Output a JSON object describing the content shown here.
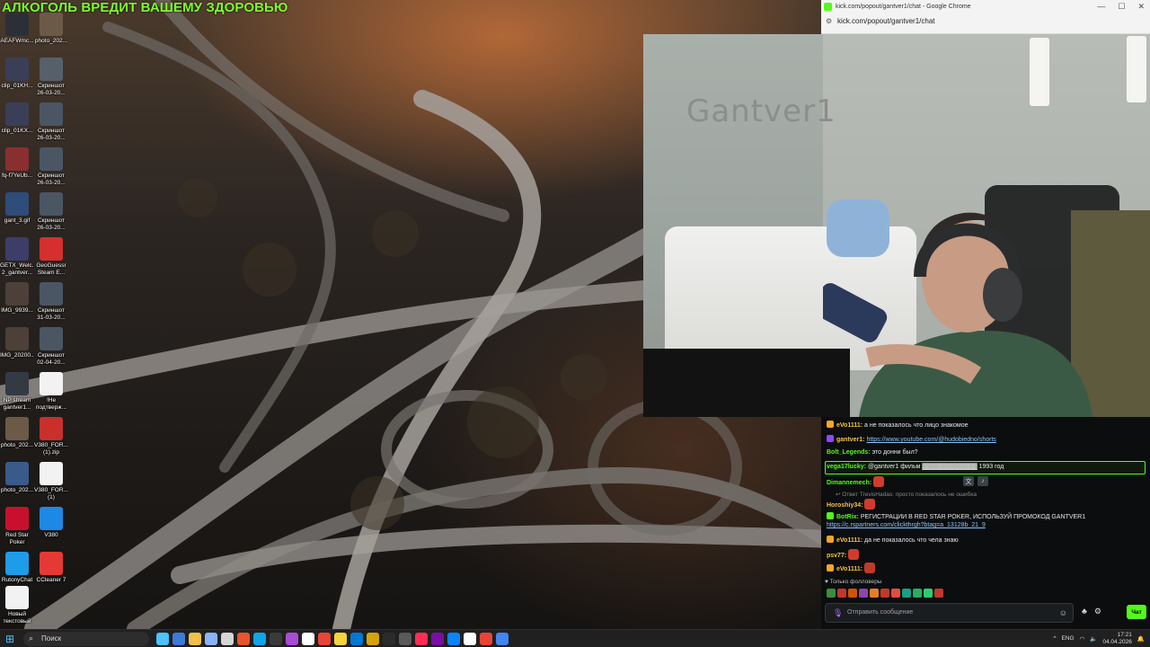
{
  "overlay": {
    "warning_text": "АЛКОГОЛЬ ВРЕДИТ ВАШЕМУ ЗДОРОВЬЮ"
  },
  "desktop": {
    "icons": [
      {
        "label": "AEAFWmc...",
        "icon": "file-icon",
        "color": "#2b2f36"
      },
      {
        "label": "photo_202...",
        "icon": "image-icon",
        "color": "#6b5a48"
      },
      {
        "label": "clip_01KH...",
        "icon": "video-icon",
        "color": "#3a3f57"
      },
      {
        "label": "Скриншот 26-03-20...",
        "icon": "screenshot-icon",
        "color": "#56606a"
      },
      {
        "label": "clip_01KX...",
        "icon": "video-icon",
        "color": "#3a3f57"
      },
      {
        "label": "Скриншот 26-03-20...",
        "icon": "screenshot-icon",
        "color": "#4b5664"
      },
      {
        "label": "fq-f7YeUb...",
        "icon": "image-icon",
        "color": "#8a2f2f"
      },
      {
        "label": "Скриншот 26-03-20...",
        "icon": "screenshot-icon",
        "color": "#4b5664"
      },
      {
        "label": "gant_3.gif",
        "icon": "gif-icon",
        "color": "#2f4d7a"
      },
      {
        "label": "Скриншот 26-03-20...",
        "icon": "screenshot-icon",
        "color": "#4b5664"
      },
      {
        "label": "GETX_Welc... 2_gantver...",
        "icon": "image-icon",
        "color": "#3d3d6a"
      },
      {
        "label": "GeoGuessr Steam E...",
        "icon": "map-pin-icon",
        "color": "#d62f2f"
      },
      {
        "label": "IMG_9939...",
        "icon": "image-icon",
        "color": "#4c4038"
      },
      {
        "label": "Скриншот 31-03-20...",
        "icon": "screenshot-icon",
        "color": "#4b5664"
      },
      {
        "label": "IMG_20200...",
        "icon": "image-icon",
        "color": "#4c4038"
      },
      {
        "label": "Скриншот 02-04-20...",
        "icon": "screenshot-icon",
        "color": "#4b5664"
      },
      {
        "label": "NP stream gantver1...",
        "icon": "document-icon",
        "color": "#333a44"
      },
      {
        "label": "!Не подтверж...",
        "icon": "text-file-icon",
        "color": "#f2f2f2"
      },
      {
        "label": "photo_202...",
        "icon": "image-icon",
        "color": "#6b5a48"
      },
      {
        "label": "V380_FOR... (1).zip",
        "icon": "archive-icon",
        "color": "#c9302c"
      },
      {
        "label": "photo_202...",
        "icon": "image-icon",
        "color": "#3a5a8a"
      },
      {
        "label": "V380_FOR... (1)",
        "icon": "app-icon",
        "color": "#f2f2f2"
      },
      {
        "label": "Red Star Poker",
        "icon": "poker-icon",
        "color": "#c8102e"
      },
      {
        "label": "V380",
        "icon": "camera-app-icon",
        "color": "#1e88e5"
      },
      {
        "label": "RutonyChat",
        "icon": "chat-app-icon",
        "color": "#1e9be9"
      },
      {
        "label": "CCleaner 7",
        "icon": "ccleaner-icon",
        "color": "#e53935"
      },
      {
        "label": "Новый текстовый ...",
        "icon": "text-file-icon",
        "color": "#f2f2f2"
      }
    ]
  },
  "browser": {
    "title": "kick.com/popout/gantver1/chat - Google Chrome",
    "url": "kick.com/popout/gantver1/chat",
    "controls": [
      "—",
      "☐",
      "✕"
    ]
  },
  "webcam": {
    "wall_logo": "Gantver1"
  },
  "chat": {
    "messages": [
      {
        "user": "eVo1111:",
        "user_color": "#f5c242",
        "badge_color": "#f5a623",
        "text": "а не показалось что лицо знакомое"
      },
      {
        "user": "gantver1:",
        "user_color": "#f5c242",
        "badge_color": "#9146ff",
        "link": "https://www.youtube.com/@hudobiedno/shorts"
      },
      {
        "user": "Bolt_Legends:",
        "user_color": "#53fc18",
        "text": "это донни был?"
      },
      {
        "user": "vega17lucky:",
        "user_color": "#53fc18",
        "text": "@gantver1 фильм ▓▓▓▓▓▓▓▓▓▓▓▓ 1993 год",
        "highlight": true
      },
      {
        "user": "Dimannemech:",
        "user_color": "#53fc18",
        "emote_color": "#d13b2e"
      },
      {
        "user": "Horoshiy34:",
        "user_color": "#f5c242",
        "emote_color": "#d13b2e"
      },
      {
        "user": "BotRix:",
        "user_color": "#53fc18",
        "badge_color": "#53fc18",
        "text": "РЕГИСТРАЦИИ В RED STAR POKER, ИСПОЛЬЗУЙ ПРОМОКОД GANTVER1",
        "link": "https://c.rspartners.com/clickthrgh?btag=a_13128b_21_9"
      },
      {
        "user": "eVo1111:",
        "user_color": "#f5c242",
        "badge_color": "#f5a623",
        "text": "да не показалось что чела знаю"
      },
      {
        "user": "psv77:",
        "user_color": "#f5c242",
        "emote_color": "#d13b2e"
      },
      {
        "user": "eVo1111:",
        "user_color": "#f5c242",
        "badge_color": "#f5a623",
        "emote_color": "#c0392b"
      }
    ],
    "reply_context": "↩ Ответ TrevisHadas: просто показалось не ошибка",
    "followers_label": "Только фолловеры",
    "input_placeholder": "Отправить сообщение",
    "send_label": "Чат",
    "emote_colors": [
      "#3c8d3c",
      "#c0392b",
      "#d35400",
      "#8e44ad",
      "#e67e22",
      "#c0392b",
      "#e74c3c",
      "#16a085",
      "#27ae60",
      "#2ecc71",
      "#c0392b"
    ]
  },
  "taskbar": {
    "search_placeholder": "Поиск",
    "language": "ENG",
    "time": "17:21",
    "date": "04.04.2026",
    "app_colors": [
      "#4cc2ff",
      "#3f7ad6",
      "#f0c04a",
      "#8ab4f8",
      "#d6d6d6",
      "#e8542b",
      "#0ea5e9",
      "#3a3a3a",
      "#a94bd6",
      "#ffffff",
      "#ea4335",
      "#f5d33d",
      "#0078d4",
      "#d4a30a",
      "#2b2b2b",
      "#5a5a5a",
      "#ff2d55",
      "#7a0ea5",
      "#0a84ff",
      "#ffffff",
      "#ea4335",
      "#4285f4"
    ]
  }
}
